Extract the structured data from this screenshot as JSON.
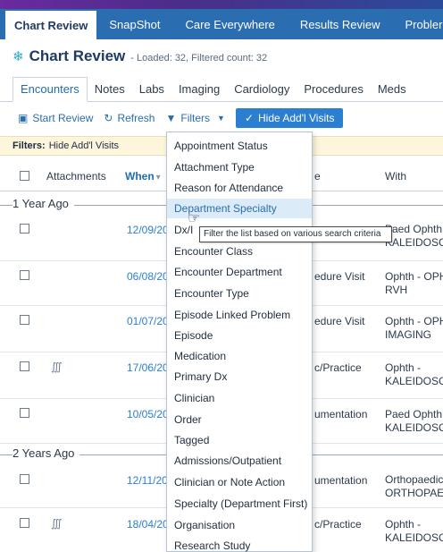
{
  "top_tabs": [
    "Chart Review",
    "SnapShot",
    "Care Everywhere",
    "Results Review",
    "Probler"
  ],
  "header": {
    "title": "Chart Review",
    "subtitle": "- Loaded: 32, Filtered count: 32"
  },
  "activity_tabs": [
    "Encounters",
    "Notes",
    "Labs",
    "Imaging",
    "Cardiology",
    "Procedures",
    "Meds"
  ],
  "toolbar": {
    "start_review": "Start Review",
    "refresh": "Refresh",
    "filters": "Filters",
    "hide_visits": "Hide Add'l Visits"
  },
  "filters_bar": {
    "label": "Filters:",
    "value": "Hide Add'l Visits"
  },
  "columns": {
    "attachments": "Attachments",
    "when": "When",
    "type": "e",
    "with": "With"
  },
  "groups": [
    "1 Year Ago",
    "2 Years Ago"
  ],
  "rows": [
    {
      "when": "12/09/20",
      "type": "",
      "with": [
        "Paed Ophth",
        "KALEIDOSCO"
      ],
      "attachment": false
    },
    {
      "when": "06/08/20",
      "type": "edure Visit",
      "with": [
        "Ophth - OPH",
        "RVH"
      ],
      "attachment": false
    },
    {
      "when": "01/07/20",
      "type": "edure Visit",
      "with": [
        "Ophth - OPH",
        "IMAGING"
      ],
      "attachment": false
    },
    {
      "when": "17/06/20",
      "type": "c/Practice",
      "with": [
        "Ophth -",
        "KALEIDOSCO"
      ],
      "attachment": true
    },
    {
      "when": "10/05/20",
      "type": "umentation",
      "with": [
        "Paed Ophth",
        "KALEIDOSCO"
      ],
      "attachment": false
    },
    {
      "when": "12/11/20",
      "type": "umentation",
      "with": [
        "Orthopaedic",
        "ORTHOPAED"
      ],
      "attachment": false
    },
    {
      "when": "18/04/20",
      "type": "c/Practice",
      "with": [
        "Ophth -",
        "KALEIDOSCO"
      ],
      "attachment": true
    }
  ],
  "dropdown_items": [
    "Appointment Status",
    "Attachment Type",
    "Reason for Attendance",
    "Department Specialty",
    "Dx/I",
    "Encounter Class",
    "Encounter Department",
    "Encounter Type",
    "Episode Linked Problem",
    "Episode",
    "Medication",
    "Primary Dx",
    "Clinician",
    "Order",
    "Tagged",
    "Admissions/Outpatient",
    "Clinician or Note Action",
    "Specialty (Department First)",
    "Organisation",
    "Research Study"
  ],
  "tooltip": "Filter the list based on various search criteria",
  "colors": {
    "brand": "#2a6db0",
    "accent": "#2a7fd1",
    "highlight": "#dcebf8",
    "filters_bg": "#fdf6dc"
  },
  "icons": [
    "pin-icon",
    "start-review-icon",
    "refresh-icon",
    "filter-icon",
    "check-icon",
    "caret-down-icon",
    "paperclip-icon",
    "sort-icon",
    "hand-cursor-icon"
  ]
}
